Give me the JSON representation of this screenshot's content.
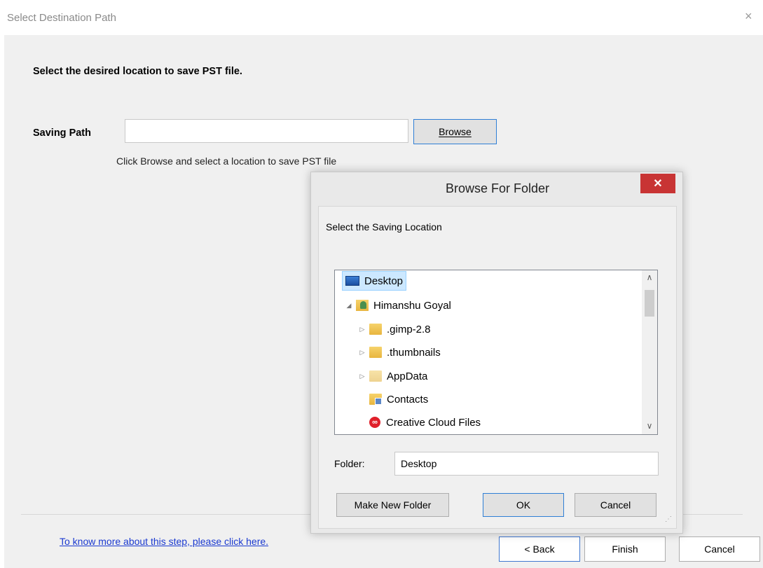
{
  "window": {
    "title": "Select Destination Path",
    "close_glyph": "×"
  },
  "main": {
    "instruction": "Select the desired location to save PST file.",
    "saving_path_label": "Saving Path",
    "saving_path_value": "",
    "browse_label": "Browse",
    "hint": "Click Browse and select a location to save PST file"
  },
  "footer": {
    "help_link": "To know more about this step, please click here.",
    "back_label": "< Back",
    "finish_label": "Finish",
    "cancel_label": "Cancel"
  },
  "dialog": {
    "title": "Browse For Folder",
    "close_glyph": "✕",
    "prompt": "Select the Saving Location",
    "tree": [
      {
        "label": "Desktop",
        "icon": "desktop-icon",
        "selected": true,
        "expander": ""
      },
      {
        "label": "Himanshu Goyal",
        "icon": "user-folder-icon",
        "expander": "◢"
      },
      {
        "label": ".gimp-2.8",
        "icon": "folder-icon",
        "expander": "▷"
      },
      {
        "label": ".thumbnails",
        "icon": "folder-icon",
        "expander": "▷"
      },
      {
        "label": "AppData",
        "icon": "folder-icon",
        "expander": "▷"
      },
      {
        "label": "Contacts",
        "icon": "contacts-folder-icon",
        "expander": ""
      },
      {
        "label": "Creative Cloud Files",
        "icon": "creative-cloud-icon",
        "expander": ""
      }
    ],
    "scroll_up_glyph": "∧",
    "scroll_down_glyph": "∨",
    "folder_label": "Folder:",
    "folder_value": "Desktop",
    "new_folder_label": "Make New Folder",
    "ok_label": "OK",
    "cancel_label": "Cancel",
    "grip_glyph": "⋰"
  }
}
